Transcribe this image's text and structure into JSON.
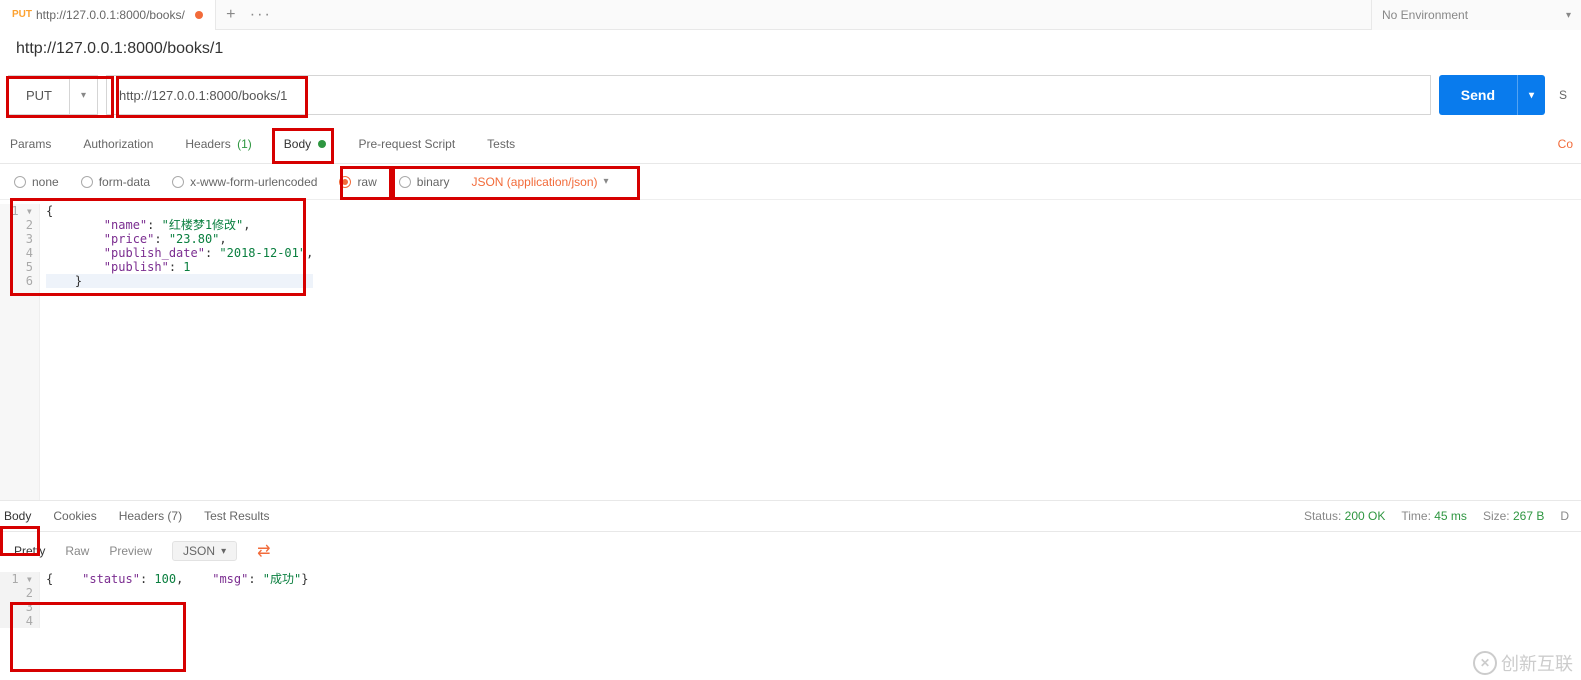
{
  "tab": {
    "method": "PUT",
    "title": "http://127.0.0.1:8000/books/"
  },
  "env_selector": "No Environment",
  "breadcrumb": "http://127.0.0.1:8000/books/1",
  "request": {
    "method": "PUT",
    "url": "http://127.0.0.1:8000/books/1",
    "send": "Send",
    "save_short": "S"
  },
  "req_tabs": {
    "params": "Params",
    "auth": "Authorization",
    "headers": "Headers",
    "headers_count": "(1)",
    "body": "Body",
    "prerequest": "Pre-request Script",
    "tests": "Tests",
    "completion": "Co"
  },
  "body_opts": {
    "none": "none",
    "formdata": "form-data",
    "urlencoded": "x-www-form-urlencoded",
    "raw": "raw",
    "binary": "binary",
    "content_type": "JSON (application/json)"
  },
  "request_body_lines": [
    {
      "n": "1",
      "fold": "▾",
      "text": "{"
    },
    {
      "n": "2",
      "text": "        \"name\": \"红楼梦1修改\","
    },
    {
      "n": "3",
      "text": "        \"price\": \"23.80\","
    },
    {
      "n": "4",
      "text": "        \"publish_date\": \"2018-12-01\","
    },
    {
      "n": "5",
      "text": "        \"publish\": 1"
    },
    {
      "n": "6",
      "text": "    }",
      "hl": true
    }
  ],
  "resp_tabs": {
    "body": "Body",
    "cookies": "Cookies",
    "headers": "Headers",
    "headers_count": "(7)",
    "tests": "Test Results"
  },
  "resp_status": {
    "status_lbl": "Status:",
    "status_val": "200 OK",
    "time_lbl": "Time:",
    "time_val": "45 ms",
    "size_lbl": "Size:",
    "size_val": "267 B",
    "download": "D"
  },
  "resp_toolbar": {
    "pretty": "Pretty",
    "raw": "Raw",
    "preview": "Preview",
    "format": "JSON"
  },
  "response_body_lines": [
    {
      "n": "1",
      "fold": "▾",
      "text": "{",
      "hl": true
    },
    {
      "n": "2",
      "text": "    \"status\": 100,"
    },
    {
      "n": "3",
      "text": "    \"msg\": \"成功\""
    },
    {
      "n": "4",
      "text": "}"
    }
  ],
  "watermark": "创新互联"
}
